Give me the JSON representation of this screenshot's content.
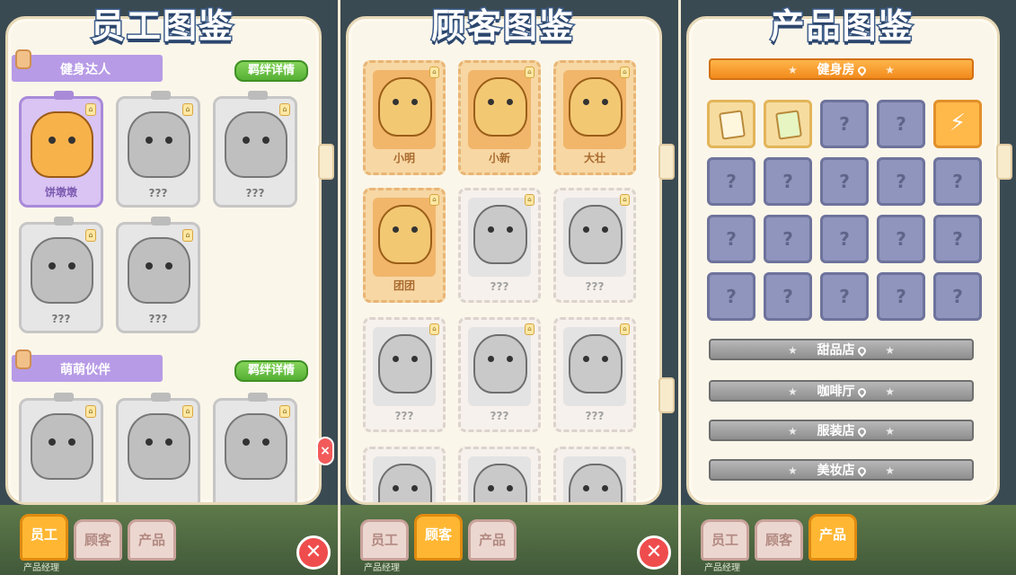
{
  "panels": {
    "staff": {
      "title": "员工图鉴",
      "sections": [
        {
          "name": "健身达人",
          "bond_button": "羁绊详情"
        },
        {
          "name": "萌萌伙伴",
          "bond_button": "羁绊详情"
        }
      ],
      "cards_section1": [
        {
          "name": "饼墩墩",
          "unlocked": true
        },
        {
          "name": "???",
          "unlocked": false
        },
        {
          "name": "???",
          "unlocked": false
        },
        {
          "name": "???",
          "unlocked": false
        },
        {
          "name": "???",
          "unlocked": false
        }
      ],
      "active_tab": "员工"
    },
    "customers": {
      "title": "顾客图鉴",
      "cards": [
        {
          "name": "小明",
          "unlocked": true
        },
        {
          "name": "小新",
          "unlocked": true
        },
        {
          "name": "大壮",
          "unlocked": true
        },
        {
          "name": "团团",
          "unlocked": true
        },
        {
          "name": "???",
          "unlocked": false
        },
        {
          "name": "???",
          "unlocked": false
        },
        {
          "name": "???",
          "unlocked": false
        },
        {
          "name": "???",
          "unlocked": false
        },
        {
          "name": "???",
          "unlocked": false
        }
      ],
      "active_tab": "顾客"
    },
    "products": {
      "title": "产品图鉴",
      "shops": [
        "健身房",
        "甜品店",
        "咖啡厅",
        "服装店",
        "美妆店"
      ],
      "products": [
        "owned",
        "owned-green",
        "locked",
        "locked",
        "bolt"
      ]
    }
  },
  "tabs": [
    "员工",
    "顾客",
    "产品"
  ],
  "bottom_label": "产品经理",
  "colors": {
    "accent": "#ffb733",
    "locked": "#8f95bd",
    "ribbon": "#b79be6",
    "bond": "#55b034"
  }
}
